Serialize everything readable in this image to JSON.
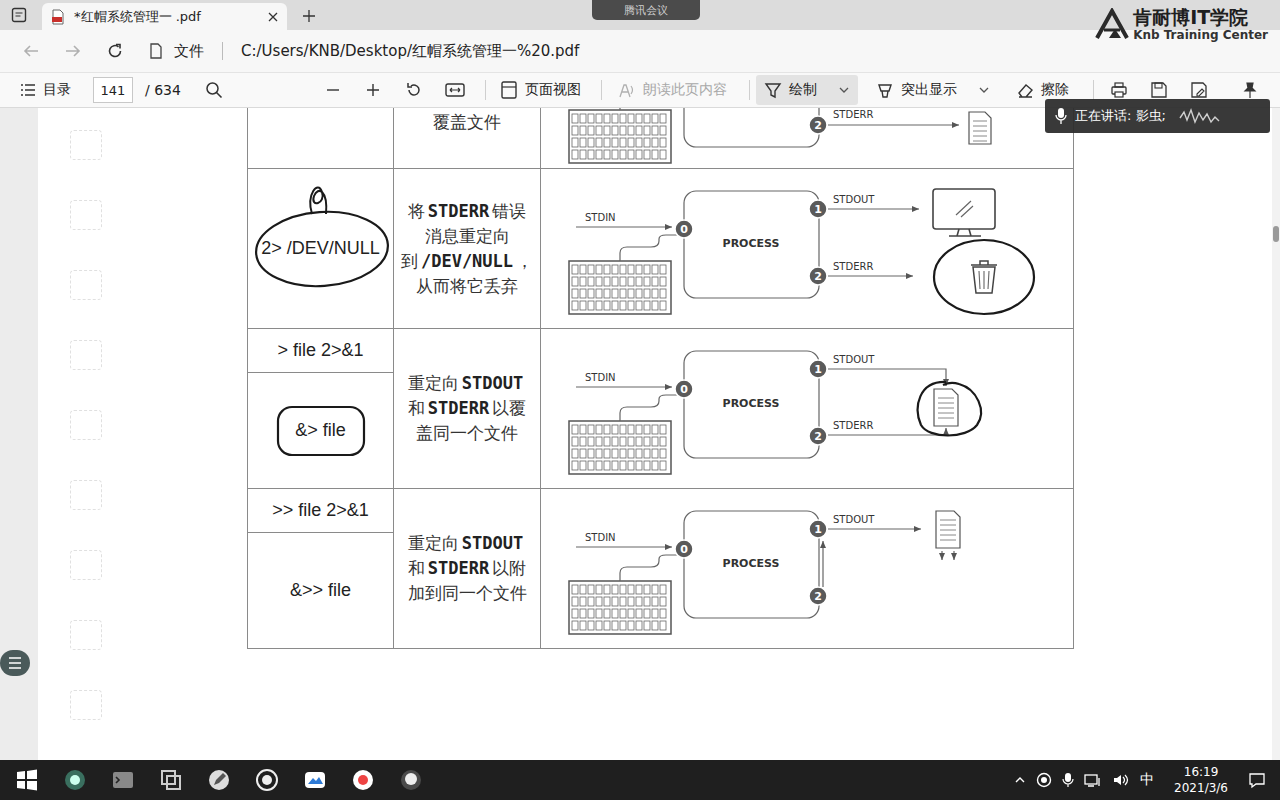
{
  "browser": {
    "tab": {
      "title": "*红帽系统管理一 .pdf",
      "selected": true
    },
    "address": {
      "scheme": "文件",
      "url": "C:/Users/KNB/Desktop/红帽系统管理一%20.pdf"
    }
  },
  "meeting_badge": "腾讯会议",
  "logo": {
    "name": "肯耐博IT学院",
    "subtitle": "Knb Training Center"
  },
  "pdf_toolbar": {
    "contents": "目录",
    "page": "141",
    "total": "/ 634",
    "page_view": "页面视图",
    "read_aloud": {
      "label": "朗读此页内容",
      "disabled": true
    },
    "tools": [
      {
        "label": "绘制",
        "selected": true,
        "has_menu": true
      },
      {
        "label": "突出显示",
        "selected": false,
        "has_menu": true
      },
      {
        "label": "擦除",
        "selected": false,
        "has_menu": false
      }
    ]
  },
  "speaking": "正在讲话: 影虫;",
  "table": {
    "rows": [
      {
        "command": [],
        "description": [
          {
            "text": "覆盖文件",
            "code": false
          }
        ],
        "diagram": {
          "kind": "partial",
          "annotated": false,
          "labels": {
            "err_port": "2",
            "stderr": "STDERR"
          }
        }
      },
      {
        "command": [
          {
            "text": "2> /DEV/NULL",
            "annotated": true
          }
        ],
        "description": [
          {
            "text": "将",
            "code": false
          },
          {
            "text": "STDERR",
            "code": true
          },
          {
            "text": "错误消息重定向到",
            "code": false
          },
          {
            "text": "/DEV/NULL",
            "code": true
          },
          {
            "text": "，从而将它丢弃",
            "code": false
          }
        ],
        "diagram": {
          "kind": "discard",
          "annotated": true,
          "labels": {
            "stdin": "STDIN",
            "in_port": "0",
            "process": "PROCESS",
            "out_port": "1",
            "stdout": "STDOUT",
            "err_port": "2",
            "stderr": "STDERR"
          }
        }
      },
      {
        "command": [
          {
            "text": "> file 2>&1",
            "annotated": false
          },
          {
            "text": "&> file",
            "annotated": true
          }
        ],
        "description": [
          {
            "text": "重定向",
            "code": false
          },
          {
            "text": "STDOUT",
            "code": true
          },
          {
            "text": "和",
            "code": false
          },
          {
            "text": "STDERR",
            "code": true
          },
          {
            "text": "以覆盖同一个文件",
            "code": false
          }
        ],
        "diagram": {
          "kind": "overwrite",
          "annotated": true,
          "labels": {
            "stdin": "STDIN",
            "in_port": "0",
            "process": "PROCESS",
            "out_port": "1",
            "stdout": "STDOUT",
            "err_port": "2",
            "stderr": "STDERR"
          }
        }
      },
      {
        "command": [
          {
            "text": ">> file 2>&1",
            "annotated": false
          },
          {
            "text": "&>> file",
            "annotated": false
          }
        ],
        "description": [
          {
            "text": "重定向",
            "code": false
          },
          {
            "text": "STDOUT",
            "code": true
          },
          {
            "text": "和",
            "code": false
          },
          {
            "text": "STDERR",
            "code": true
          },
          {
            "text": "以附加到同一个文件",
            "code": false
          }
        ],
        "diagram": {
          "kind": "append",
          "annotated": false,
          "labels": {
            "stdin": "STDIN",
            "in_port": "0",
            "process": "PROCESS",
            "out_port": "1",
            "stdout": "STDOUT",
            "err_port": "2"
          }
        }
      }
    ]
  },
  "taskbar": {
    "ime": "中",
    "time": "16:19",
    "date": "2021/3/6"
  }
}
